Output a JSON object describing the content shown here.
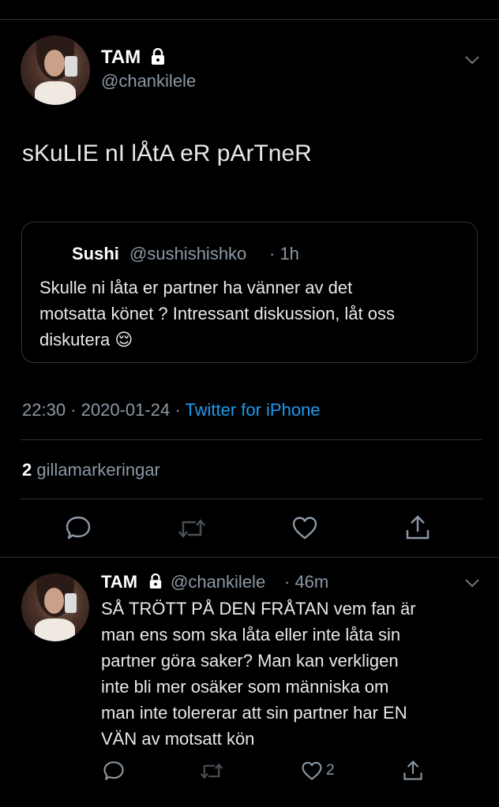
{
  "main_tweet": {
    "author": {
      "name": "TAM",
      "handle": "@chankilele"
    },
    "text": "sKuLIE nI lÅtA eR pArTneR",
    "quoted": {
      "name": "Sushi",
      "handle": "@sushishishko",
      "time": "· 1h",
      "text_lines": [
        "Skulle ni låta er partner ha vänner av det",
        "motsatta könet ? Intressant diskussion, låt oss",
        "diskutera 😌"
      ]
    },
    "meta": {
      "time": "22:30",
      "date": "2020-01-24",
      "sep1": "·",
      "sep2": "·",
      "source": "Twitter for iPhone"
    },
    "likes": {
      "count": "2",
      "label": "gillamarkeringar"
    }
  },
  "reply_tweet": {
    "author": {
      "name": "TAM",
      "handle": "@chankilele",
      "time": "· 46m"
    },
    "text_lines": [
      "SÅ TRÖTT PÅ DEN FRÅTAN vem fan är",
      "man ens som ska låta eller inte låta sin",
      "partner göra saker? Man kan verkligen",
      "inte bli mer osäker som människa om",
      "man inte tolererar att sin partner har EN",
      "VÄN av motsatt kön"
    ],
    "like_count": "2"
  },
  "icons": {
    "lock": "lock-icon",
    "chevron": "chevron-down-icon",
    "reply": "reply-icon",
    "retweet": "retweet-icon",
    "like": "heart-icon",
    "share": "share-icon"
  },
  "colors": {
    "accent": "#1d9bf0",
    "muted": "#8b98a5",
    "divider": "#2f3336",
    "background": "#000000"
  }
}
